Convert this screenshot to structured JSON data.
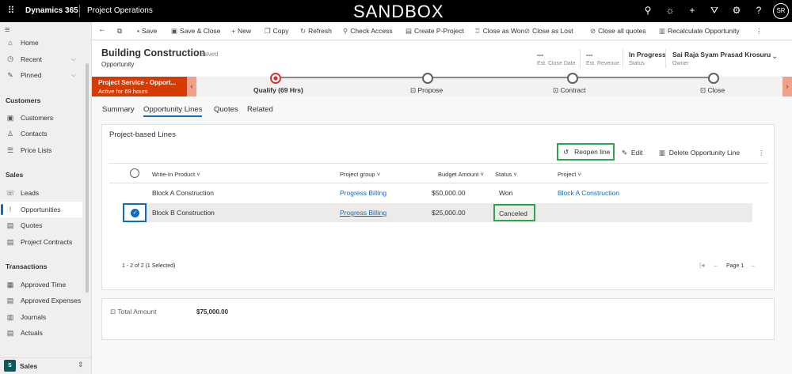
{
  "topbar": {
    "app": "Dynamics 365",
    "area": "Project Operations",
    "env": "SANDBOX",
    "avatar": "SR"
  },
  "sidebar": {
    "nav": [
      {
        "label": "Home",
        "icon": "⌂"
      },
      {
        "label": "Recent",
        "icon": "◷"
      },
      {
        "label": "Pinned",
        "icon": "✎"
      }
    ],
    "groups": [
      {
        "title": "Customers",
        "items": [
          {
            "label": "Customers",
            "icon": "▣"
          },
          {
            "label": "Contacts",
            "icon": "♙"
          },
          {
            "label": "Price Lists",
            "icon": "☰"
          }
        ]
      },
      {
        "title": "Sales",
        "items": [
          {
            "label": "Leads",
            "icon": "☏"
          },
          {
            "label": "Opportunities",
            "icon": "!"
          },
          {
            "label": "Quotes",
            "icon": "▤"
          },
          {
            "label": "Project Contracts",
            "icon": "▤"
          }
        ]
      },
      {
        "title": "Transactions",
        "items": [
          {
            "label": "Approved Time",
            "icon": "▦"
          },
          {
            "label": "Approved Expenses",
            "icon": "▤"
          },
          {
            "label": "Journals",
            "icon": "▥"
          },
          {
            "label": "Actuals",
            "icon": "▤"
          }
        ]
      }
    ],
    "area_switcher": {
      "badge": "S",
      "label": "Sales"
    }
  },
  "commands": [
    {
      "label": "Save",
      "icon": "▪"
    },
    {
      "label": "Save & Close",
      "icon": "▣"
    },
    {
      "label": "New",
      "icon": "+"
    },
    {
      "label": "Copy",
      "icon": "❐"
    },
    {
      "label": "Refresh",
      "icon": "↻"
    },
    {
      "label": "Check Access",
      "icon": "⚲"
    },
    {
      "label": "Create P-Project",
      "icon": "▤"
    },
    {
      "label": "Close as Won",
      "icon": "♖"
    },
    {
      "label": "Close as Lost",
      "icon": "⊘"
    },
    {
      "label": "Close all quotes",
      "icon": "⊘"
    },
    {
      "label": "Recalculate Opportunity",
      "icon": "▥"
    }
  ],
  "header": {
    "title": "Building Construction",
    "saved": "- Saved",
    "entity": "Opportunity",
    "fields": [
      {
        "value": "---",
        "label": "Est. Close Date"
      },
      {
        "value": "---",
        "label": "Est. Revenue"
      },
      {
        "value": "In Progress",
        "label": "Status"
      },
      {
        "value": "Sai Raja Syam Prasad Krosuru",
        "label": "Owner"
      }
    ]
  },
  "bpf": {
    "process": "Project Service - Opport...",
    "active": "Active for 69 hours",
    "stages": [
      {
        "label": "Qualify  (69 Hrs)"
      },
      {
        "label": "Propose"
      },
      {
        "label": "Contract"
      },
      {
        "label": "Close"
      }
    ]
  },
  "tabs": [
    "Summary",
    "Opportunity Lines",
    "Quotes",
    "Related"
  ],
  "lines": {
    "title": "Project-based Lines",
    "actions": {
      "reopen": "Reopen line",
      "edit": "Edit",
      "delete": "Delete Opportunity Line"
    },
    "columns": [
      "Write-In Product",
      "Project group",
      "Budget Amount",
      "Status",
      "Project"
    ],
    "rows": [
      {
        "product": "Block A Construction",
        "group": "Progress Billing",
        "amount": "$50,000.00",
        "status": "Won",
        "project": "Block A Construction"
      },
      {
        "product": "Block B Construction",
        "group": "Progress Billing",
        "amount": "$25,000.00",
        "status": "Canceled",
        "project": ""
      }
    ],
    "footer": "1 - 2 of 2 (1 Selected)",
    "page": "Page 1"
  },
  "total": {
    "label": "Total Amount",
    "value": "$75,000.00"
  }
}
